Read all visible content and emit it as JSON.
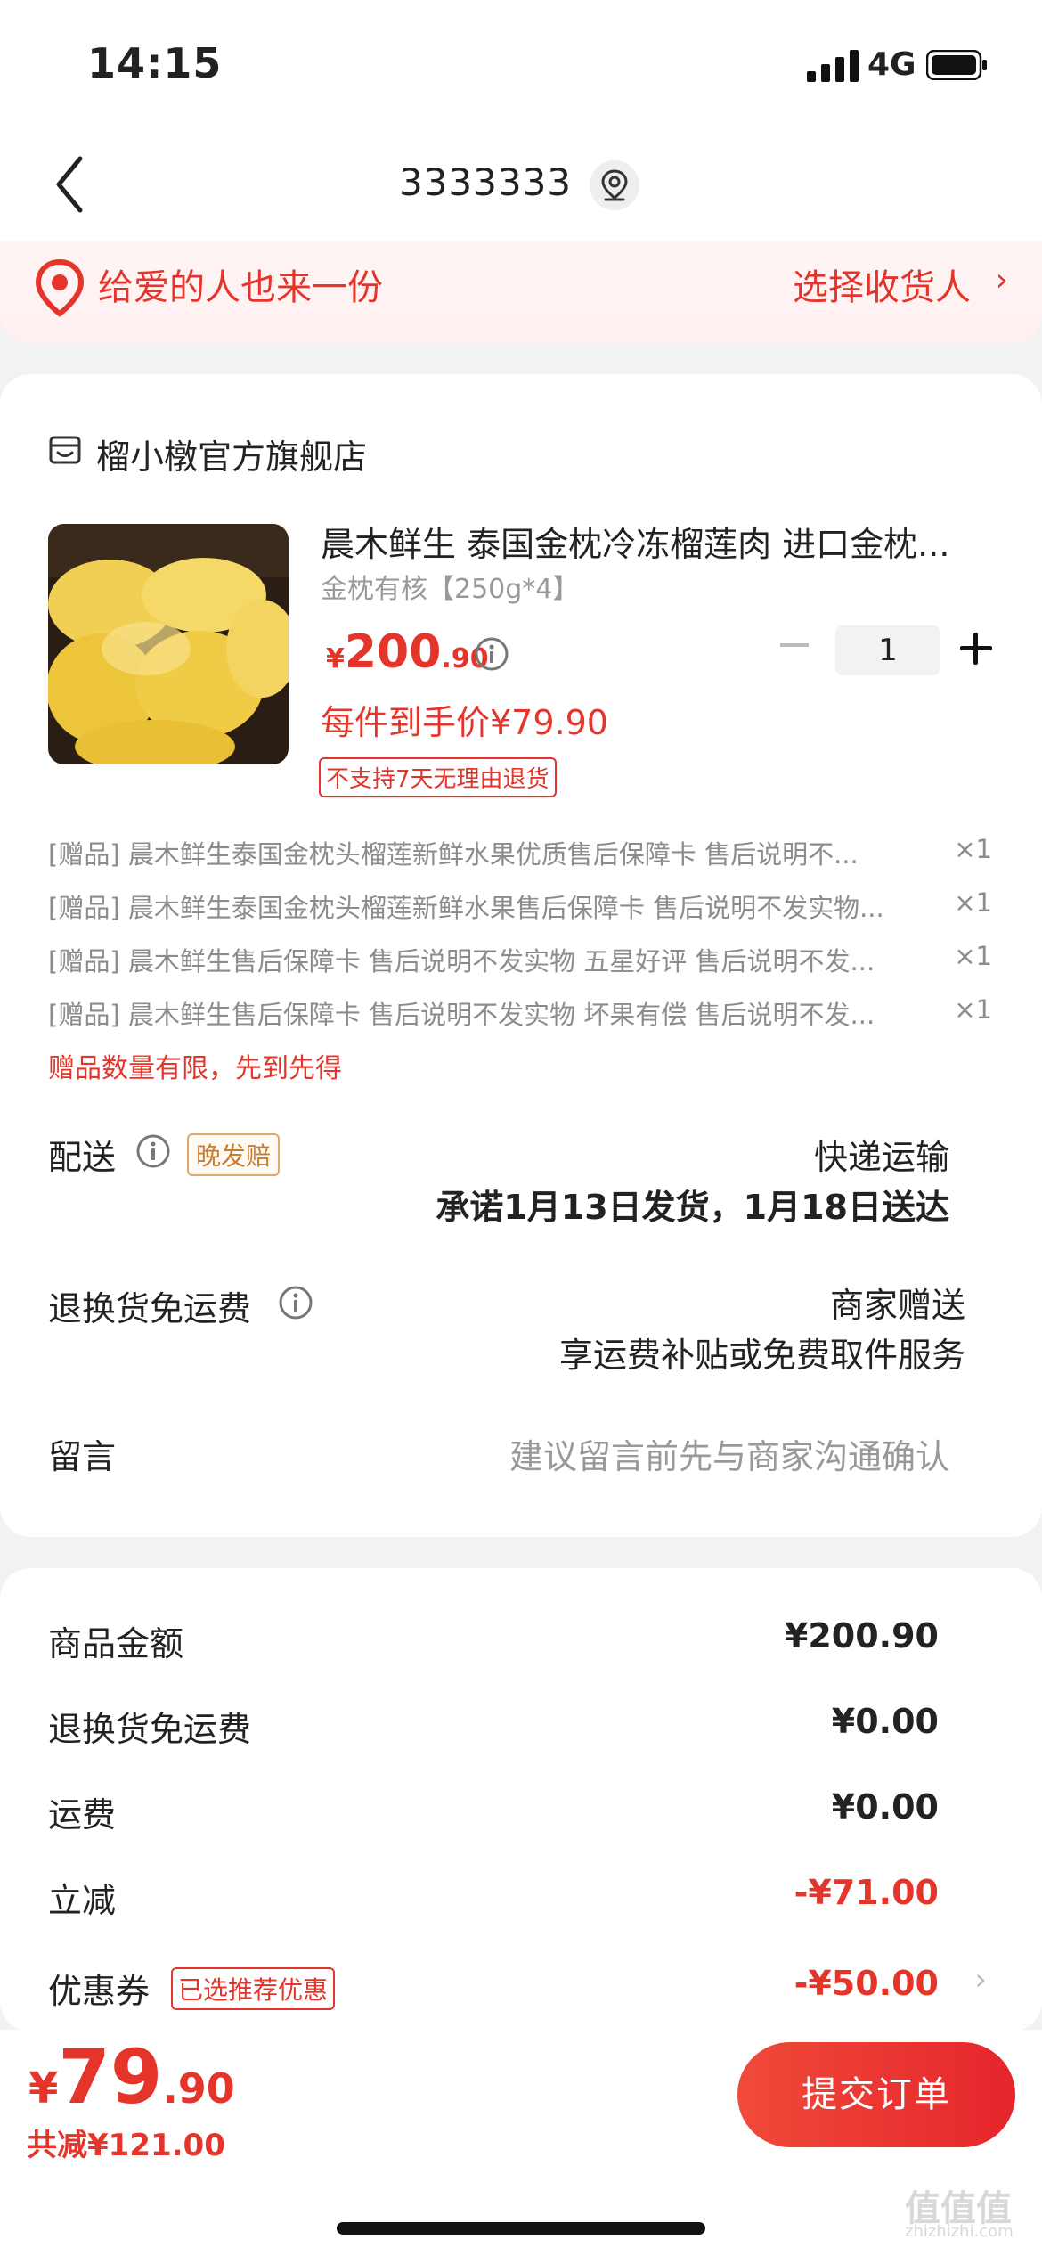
{
  "status": {
    "time": "14:15",
    "network": "4G"
  },
  "nav": {
    "title": "3333333"
  },
  "gift_strip": {
    "text": "给爱的人也来一份",
    "select_label": "选择收货人",
    "chevron": "›"
  },
  "store": {
    "name": "榴小橔官方旗舰店"
  },
  "product": {
    "title": "晨木鲜生 泰国金枕冷冻榴莲肉 进口金枕...",
    "spec": "金枕有核【250g*4】",
    "price_symbol": "¥",
    "price_int": "200",
    "price_dec": ".90",
    "unit_price": "每件到手价¥79.90",
    "no_return": "不支持7天无理由退货",
    "quantity": "1"
  },
  "gifts": [
    {
      "text": "[赠品] 晨木鲜生泰国金枕头榴莲新鲜水果优质售后保障卡 售后说明不...",
      "count": "×1"
    },
    {
      "text": "[赠品] 晨木鲜生泰国金枕头榴莲新鲜水果售后保障卡 售后说明不发实物...",
      "count": "×1"
    },
    {
      "text": "[赠品] 晨木鲜生售后保障卡 售后说明不发实物 五星好评 售后说明不发...",
      "count": "×1"
    },
    {
      "text": "[赠品] 晨木鲜生售后保障卡 售后说明不发实物 坏果有偿 售后说明不发...",
      "count": "×1"
    }
  ],
  "gift_note": "赠品数量有限，先到先得",
  "delivery": {
    "label": "配送",
    "badge": "晚发赔",
    "method": "快递运输",
    "promise": "承诺1月13日发货，1月18日送达"
  },
  "return_shipping": {
    "label": "退换货免运费",
    "value": "商家赠送",
    "desc": "享运费补贴或免费取件服务"
  },
  "message": {
    "label": "留言",
    "placeholder": "建议留言前先与商家沟通确认"
  },
  "summary": {
    "goods_label": "商品金额",
    "goods_value": "¥200.90",
    "return_label": "退换货免运费",
    "return_value": "¥0.00",
    "shipping_label": "运费",
    "shipping_value": "¥0.00",
    "discount_label": "立减",
    "discount_value": "-¥71.00",
    "coupon_label": "优惠券",
    "coupon_tag": "已选推荐优惠",
    "coupon_value": "-¥50.00",
    "coupon_chevron": "›"
  },
  "bottom": {
    "total_symbol": "¥",
    "total_int": "79",
    "total_dec": ".90",
    "saved": "共减¥121.00",
    "submit_label": "提交订单"
  },
  "watermark": {
    "text": "值值值",
    "sub": "zhizhizhi.com"
  },
  "colors": {
    "accent": "#e5352b",
    "muted": "#999999",
    "badge_orange": "#c77d2f"
  }
}
